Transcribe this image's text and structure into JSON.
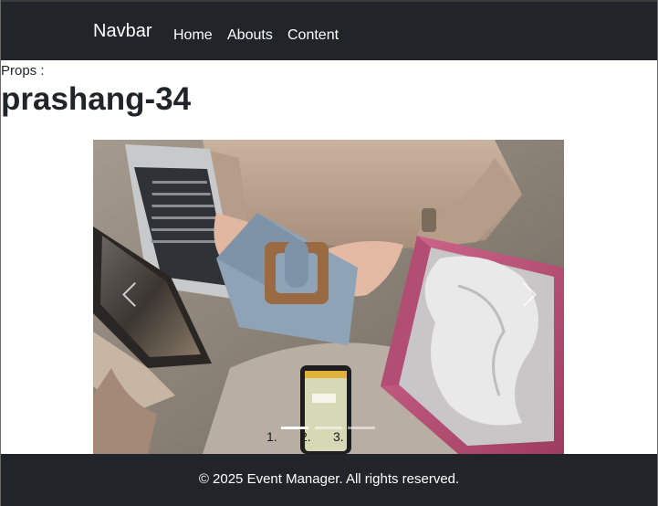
{
  "navbar": {
    "brand": "Navbar",
    "links": [
      {
        "label": "Home"
      },
      {
        "label": "Abouts"
      },
      {
        "label": "Content"
      }
    ],
    "background": "#212529"
  },
  "main": {
    "props_label": "Props :",
    "heading": "prashang-34"
  },
  "carousel": {
    "slides": [
      {
        "label": "1."
      },
      {
        "label": "2."
      },
      {
        "label": "3."
      }
    ],
    "active_slide": 1,
    "prev_icon": "chevron-left-icon",
    "next_icon": "chevron-right-icon"
  },
  "footer": {
    "text": "© 2025 Event Manager. All rights reserved."
  }
}
